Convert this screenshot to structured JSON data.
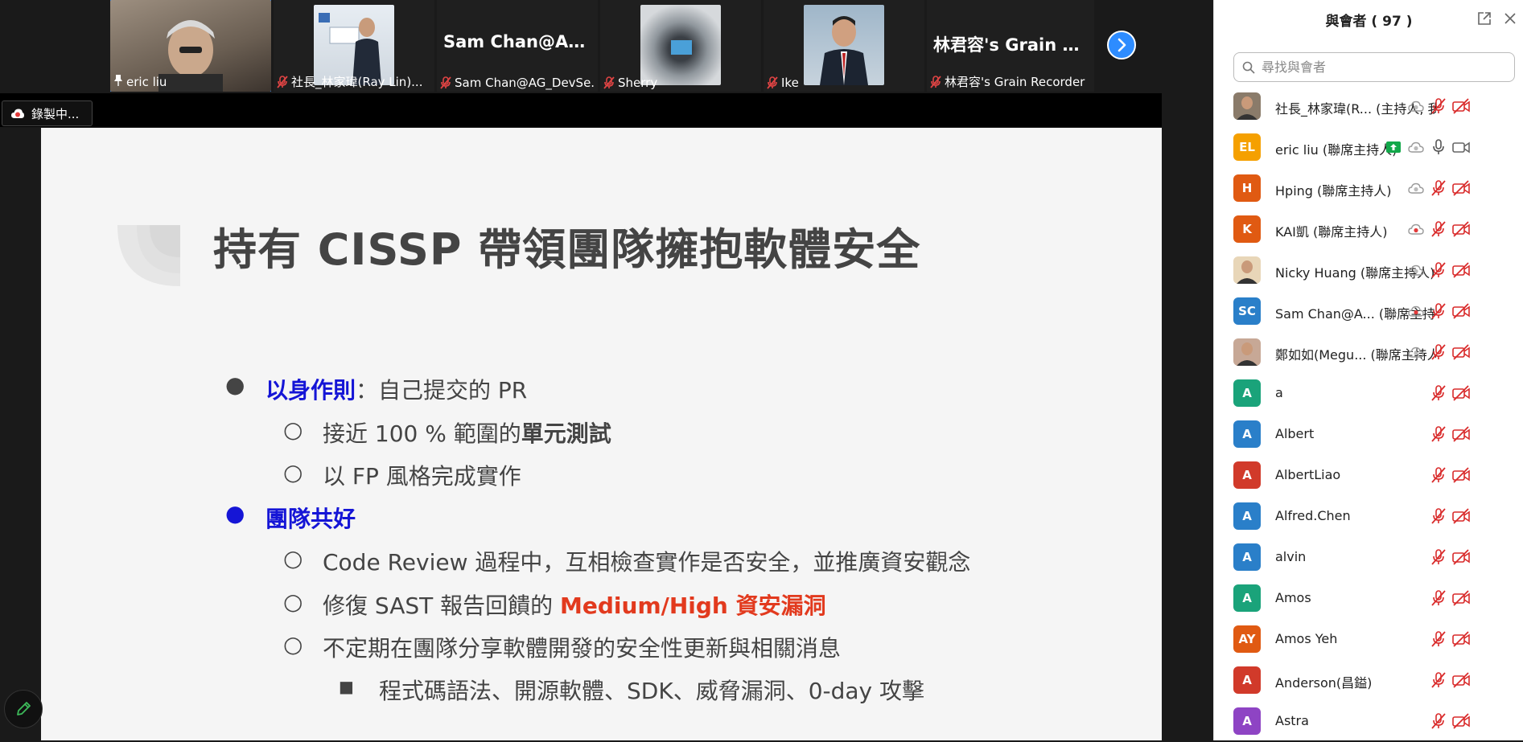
{
  "strip": {
    "tiles": [
      {
        "label": "eric liu",
        "pinned": true
      },
      {
        "label": "社長_林家瑋(Ray Lin)..."
      },
      {
        "big": "Sam  Chan@AG_...",
        "label": "Sam Chan@AG_DevSe..."
      },
      {
        "label": "Sherry"
      },
      {
        "label": "Ike"
      },
      {
        "big": "林君容's Grain R...",
        "label": "林君容's Grain Recorder"
      }
    ],
    "next_icon": "chevron-right-icon"
  },
  "recording": {
    "label": "錄製中..."
  },
  "slide": {
    "title": "持有 CISSP 帶領團隊擁抱軟體安全",
    "b1": {
      "hl": "以身作則",
      "rest": "：自己提交的 PR"
    },
    "b1a": {
      "pre": "接近 100 % 範圍的",
      "strong": "單元測試"
    },
    "b1b": "以 FP 風格完成實作",
    "b2": "團隊共好",
    "b2a": "Code Review 過程中，互相檢查實作是否安全，並推廣資安觀念",
    "b2b": {
      "pre": "修復 SAST 報告回饋的 ",
      "red": "Medium/High 資安漏洞"
    },
    "b2c": "不定期在團隊分享軟體開發的安全性更新與相關消息",
    "b2c1": "程式碼語法、開源軟體、SDK、威脅漏洞、0-day 攻擊"
  },
  "panel": {
    "title": "與會者 ( 97 )",
    "search_placeholder": "尋找與會者",
    "participants": [
      {
        "name": "社長_林家瑋(R... (主持人, 我)",
        "avatar": "",
        "color": "#8a7b6a",
        "photo": true
      },
      {
        "name": "eric liu (聯席主持人)",
        "avatar": "EL",
        "color": "#f5a000",
        "sharing": true,
        "mic_on": true
      },
      {
        "name": "Hping (聯席主持人)",
        "avatar": "H",
        "color": "#e05a12"
      },
      {
        "name": "KAI凱 (聯席主持人)",
        "avatar": "K",
        "color": "#e05a12",
        "rec_red": true
      },
      {
        "name": "Nicky Huang (聯席主持人)",
        "avatar": "",
        "color": "#e8d6b8",
        "photo": true
      },
      {
        "name": "Sam Chan@A... (聯席主持人)",
        "avatar": "SC",
        "color": "#2a7fc9",
        "rec_red": true
      },
      {
        "name": "鄭如如(Megu... (聯席主持人)",
        "avatar": "",
        "color": "#c7a896",
        "photo": true
      },
      {
        "name": "a",
        "avatar": "A",
        "color": "#1aa37a",
        "guest": true
      },
      {
        "name": "Albert",
        "avatar": "A",
        "color": "#2a7fc9",
        "guest": true
      },
      {
        "name": "AlbertLiao",
        "avatar": "A",
        "color": "#d13a2a",
        "guest": true
      },
      {
        "name": "Alfred.Chen",
        "avatar": "A",
        "color": "#2a7fc9",
        "guest": true
      },
      {
        "name": "alvin",
        "avatar": "A",
        "color": "#2a7fc9",
        "guest": true
      },
      {
        "name": "Amos",
        "avatar": "A",
        "color": "#1aa37a",
        "guest": true
      },
      {
        "name": "Amos Yeh",
        "avatar": "AY",
        "color": "#e05a12",
        "guest": true
      },
      {
        "name": "Anderson(昌鎰)",
        "avatar": "A",
        "color": "#d13a2a",
        "guest": true
      },
      {
        "name": "Astra",
        "avatar": "A",
        "color": "#8e44c4",
        "guest": true
      }
    ]
  },
  "colors": {
    "accent": "#2d8cff",
    "muted_red": "#d92b2b",
    "share_green": "#12a84a"
  }
}
